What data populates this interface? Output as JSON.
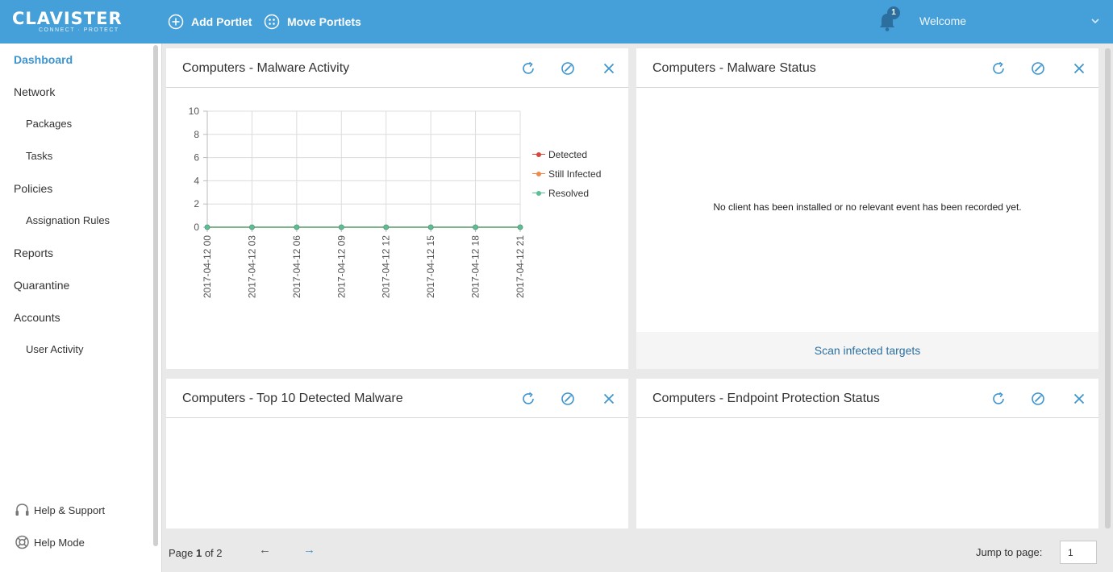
{
  "topbar": {
    "logo_main": "CLAVISTER",
    "logo_tagline": "CONNECT · PROTECT",
    "add_portlet": "Add Portlet",
    "move_portlets": "Move Portlets",
    "notification_count": "1",
    "welcome": "Welcome",
    "accent_color": "#459fd8"
  },
  "sidebar": {
    "dashboard": "Dashboard",
    "network": "Network",
    "packages": "Packages",
    "tasks": "Tasks",
    "policies": "Policies",
    "assignation_rules": "Assignation Rules",
    "reports": "Reports",
    "quarantine": "Quarantine",
    "accounts": "Accounts",
    "user_activity": "User Activity",
    "help_support": "Help & Support",
    "help_mode": "Help Mode"
  },
  "portlets": {
    "malware_activity": {
      "title": "Computers - Malware Activity",
      "icons": [
        "refresh-icon",
        "settings-icon",
        "close-icon"
      ]
    },
    "malware_status": {
      "title": "Computers - Malware Status",
      "message": "No client has been installed or no relevant event has been recorded yet.",
      "footer_link": "Scan infected targets"
    },
    "top10_malware": {
      "title": "Computers - Top 10 Detected Malware"
    },
    "endpoint_status": {
      "title": "Computers - Endpoint Protection Status"
    }
  },
  "chart_data": {
    "type": "line",
    "x": [
      "2017-04-12 00",
      "2017-04-12 03",
      "2017-04-12 06",
      "2017-04-12 09",
      "2017-04-12 12",
      "2017-04-12 15",
      "2017-04-12 18",
      "2017-04-12 21"
    ],
    "yticks": [
      0,
      2,
      4,
      6,
      8,
      10
    ],
    "ylim": [
      0,
      10
    ],
    "grid": true,
    "legend_position": "right",
    "series": [
      {
        "name": "Detected",
        "color": "#d9473b",
        "values": [
          0,
          0,
          0,
          0,
          0,
          0,
          0,
          0
        ]
      },
      {
        "name": "Still Infected",
        "color": "#f08a4b",
        "values": [
          0,
          0,
          0,
          0,
          0,
          0,
          0,
          0
        ]
      },
      {
        "name": "Resolved",
        "color": "#5bbf95",
        "values": [
          0,
          0,
          0,
          0,
          0,
          0,
          0,
          0
        ]
      }
    ]
  },
  "pagination": {
    "page_prefix": "Page ",
    "current_page": "1",
    "page_suffix": " of 2",
    "prev_arrow": "←",
    "next_arrow": "→",
    "jump_label": "Jump to page:",
    "jump_value": "1"
  }
}
